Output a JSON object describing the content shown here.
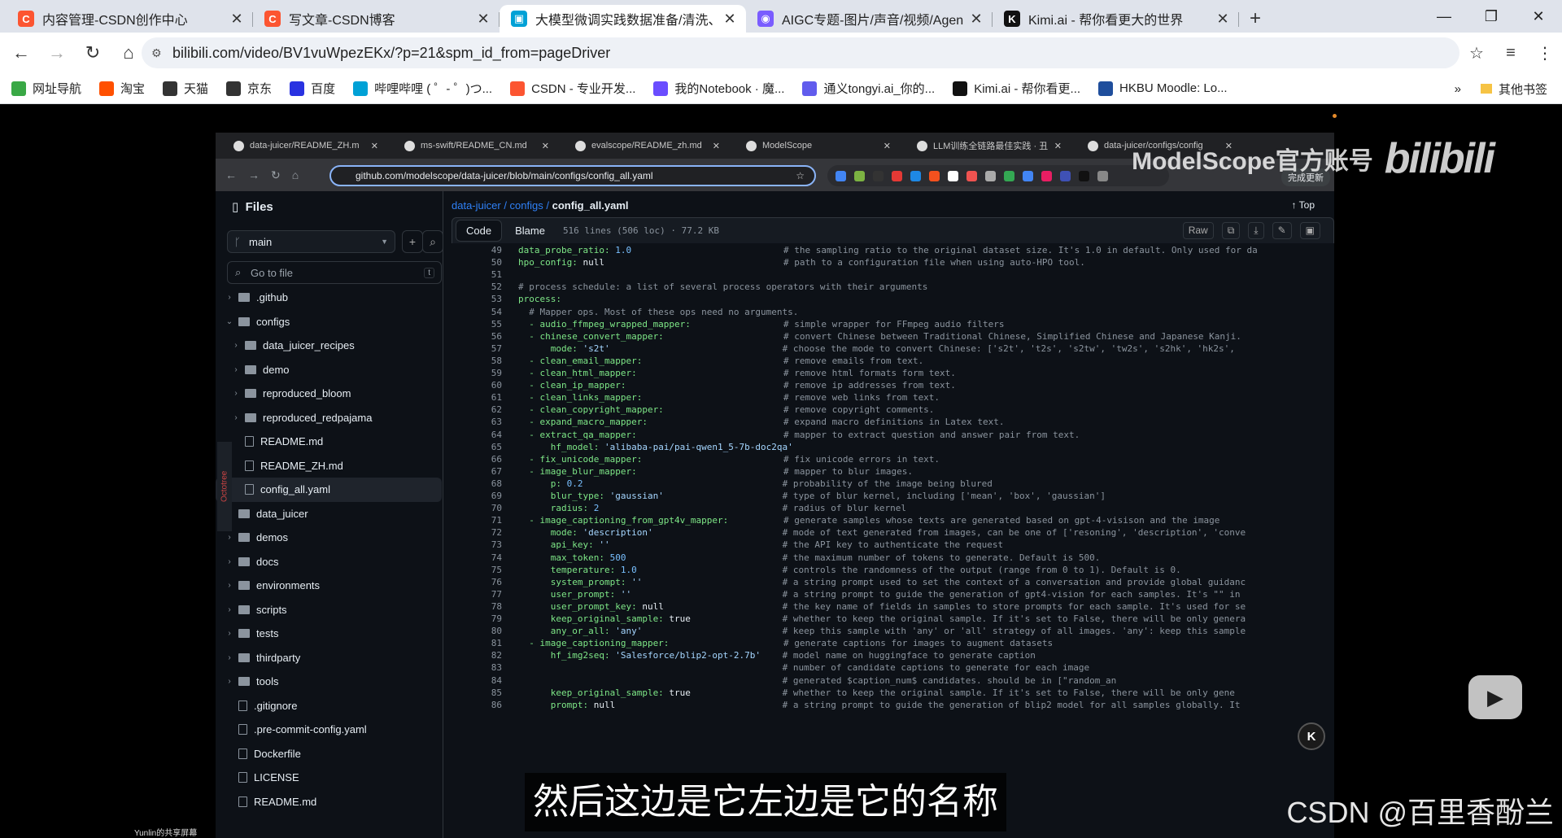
{
  "browser": {
    "tabs": [
      {
        "title": "内容管理-CSDN创作中心",
        "fav": "C",
        "color": "#fc5531"
      },
      {
        "title": "写文章-CSDN博客",
        "fav": "C",
        "color": "#fc5531"
      },
      {
        "title": "大模型微调实践数据准备/清洗、",
        "fav": "▣",
        "color": "#00a1d6",
        "active": true
      },
      {
        "title": "AIGC专题-图片/声音/视频/Agen",
        "fav": "◉",
        "color": "#7a5cff"
      },
      {
        "title": "Kimi.ai - 帮你看更大的世界",
        "fav": "K",
        "color": "#111111"
      }
    ],
    "url": "bilibili.com/video/BV1vuWpezEKx/?p=21&spm_id_from=pageDriver",
    "bookmarks": [
      {
        "label": "网址导航",
        "color": "#39a845"
      },
      {
        "label": "淘宝",
        "color": "#ff5000"
      },
      {
        "label": "天猫",
        "color": "#333333"
      },
      {
        "label": "京东",
        "color": "#333333"
      },
      {
        "label": "百度",
        "color": "#2932e1"
      },
      {
        "label": "哔哩哔哩 ( ゜- ゜)つ...",
        "color": "#00a1d6"
      },
      {
        "label": "CSDN - 专业开发...",
        "color": "#fc5531"
      },
      {
        "label": "我的Notebook · 魔...",
        "color": "#6a4dff"
      },
      {
        "label": "通义tongyi.ai_你的...",
        "color": "#615ced"
      },
      {
        "label": "Kimi.ai - 帮你看更...",
        "color": "#111111"
      },
      {
        "label": "HKBU Moodle: Lo...",
        "color": "#1f4e9c"
      }
    ],
    "other_bookmarks": "其他书签"
  },
  "inner": {
    "tabs": [
      "data-juicer/README_ZH.m",
      "ms-swift/README_CN.md",
      "evalscope/README_zh.md",
      "ModelScope",
      "LLM训练全链路最佳实践 · 丑",
      "data-juicer/configs/config"
    ],
    "url": "github.com/modelscope/data-juicer/blob/main/configs/config_all.yaml",
    "update_btn": "完成更新",
    "files_title": "Files",
    "branch": "main",
    "goto": "Go to file",
    "goto_key": "t",
    "octotree": "Octotree",
    "tree": [
      {
        "name": ".github",
        "type": "folder",
        "depth": 0,
        "caret": "›"
      },
      {
        "name": "configs",
        "type": "folder",
        "depth": 0,
        "caret": "⌄"
      },
      {
        "name": "data_juicer_recipes",
        "type": "folder",
        "depth": 1,
        "caret": "›"
      },
      {
        "name": "demo",
        "type": "folder",
        "depth": 1,
        "caret": "›"
      },
      {
        "name": "reproduced_bloom",
        "type": "folder",
        "depth": 1,
        "caret": "›"
      },
      {
        "name": "reproduced_redpajama",
        "type": "folder",
        "depth": 1,
        "caret": "›"
      },
      {
        "name": "README.md",
        "type": "file",
        "depth": 1,
        "caret": ""
      },
      {
        "name": "README_ZH.md",
        "type": "file",
        "depth": 1,
        "caret": ""
      },
      {
        "name": "config_all.yaml",
        "type": "file",
        "depth": 1,
        "caret": "",
        "selected": true
      },
      {
        "name": "data_juicer",
        "type": "folder",
        "depth": 0,
        "caret": "›"
      },
      {
        "name": "demos",
        "type": "folder",
        "depth": 0,
        "caret": "›"
      },
      {
        "name": "docs",
        "type": "folder",
        "depth": 0,
        "caret": "›"
      },
      {
        "name": "environments",
        "type": "folder",
        "depth": 0,
        "caret": "›"
      },
      {
        "name": "scripts",
        "type": "folder",
        "depth": 0,
        "caret": "›"
      },
      {
        "name": "tests",
        "type": "folder",
        "depth": 0,
        "caret": "›"
      },
      {
        "name": "thirdparty",
        "type": "folder",
        "depth": 0,
        "caret": "›"
      },
      {
        "name": "tools",
        "type": "folder",
        "depth": 0,
        "caret": "›"
      },
      {
        "name": ".gitignore",
        "type": "file",
        "depth": 0,
        "caret": ""
      },
      {
        "name": ".pre-commit-config.yaml",
        "type": "file",
        "depth": 0,
        "caret": ""
      },
      {
        "name": "Dockerfile",
        "type": "file",
        "depth": 0,
        "caret": ""
      },
      {
        "name": "LICENSE",
        "type": "file",
        "depth": 0,
        "caret": ""
      },
      {
        "name": "README.md",
        "type": "file",
        "depth": 0,
        "caret": ""
      }
    ],
    "breadcrumb": {
      "repo": "data-juicer",
      "sep": " / ",
      "dir": "configs",
      "file": "config_all.yaml"
    },
    "top": "↑ Top",
    "code_tab": "Code",
    "blame_tab": "Blame",
    "file_info": "516 lines (506 loc) · 77.2 KB",
    "raw": "Raw",
    "code": [
      {
        "n": "49",
        "k": "data_probe_ratio:",
        "v": " 1.0",
        "vt": "n",
        "ind": 0,
        "c": "# the sampling ratio to the original dataset size. It's 1.0 in default. Only used for da"
      },
      {
        "n": "50",
        "k": "hpo_config:",
        "v": " null",
        "vt": "t",
        "ind": 0,
        "c": "# path to a configuration file when using auto-HPO tool."
      },
      {
        "n": "51",
        "k": "",
        "v": "",
        "vt": "t",
        "ind": 0,
        "c": ""
      },
      {
        "n": "52",
        "k": "",
        "v": "# process schedule: a list of several process operators with their arguments",
        "vt": "c",
        "ind": 0,
        "c": ""
      },
      {
        "n": "53",
        "k": "process:",
        "v": "",
        "vt": "t",
        "ind": 0,
        "c": ""
      },
      {
        "n": "54",
        "k": "",
        "v": "  # Mapper ops. Most of these ops need no arguments.",
        "vt": "c",
        "ind": 0,
        "c": ""
      },
      {
        "n": "55",
        "k": "  - audio_ffmpeg_wrapped_mapper:",
        "v": "",
        "vt": "t",
        "ind": 0,
        "c": "# simple wrapper for FFmpeg audio filters"
      },
      {
        "n": "56",
        "k": "  - chinese_convert_mapper:",
        "v": "",
        "vt": "t",
        "ind": 0,
        "c": "# convert Chinese between Traditional Chinese, Simplified Chinese and Japanese Kanji."
      },
      {
        "n": "57",
        "k": "      mode:",
        "v": " 's2t'",
        "vt": "s",
        "ind": 0,
        "c": " # choose the mode to convert Chinese: ['s2t', 't2s', 's2tw', 'tw2s', 's2hk', 'hk2s',"
      },
      {
        "n": "58",
        "k": "  - clean_email_mapper:",
        "v": "",
        "vt": "t",
        "ind": 0,
        "c": "# remove emails from text."
      },
      {
        "n": "59",
        "k": "  - clean_html_mapper:",
        "v": "",
        "vt": "t",
        "ind": 0,
        "c": "# remove html formats form text."
      },
      {
        "n": "60",
        "k": "  - clean_ip_mapper:",
        "v": "",
        "vt": "t",
        "ind": 0,
        "c": "# remove ip addresses from text."
      },
      {
        "n": "61",
        "k": "  - clean_links_mapper:",
        "v": "",
        "vt": "t",
        "ind": 0,
        "c": "# remove web links from text."
      },
      {
        "n": "62",
        "k": "  - clean_copyright_mapper:",
        "v": "",
        "vt": "t",
        "ind": 0,
        "c": "# remove copyright comments."
      },
      {
        "n": "63",
        "k": "  - expand_macro_mapper:",
        "v": "",
        "vt": "t",
        "ind": 0,
        "c": "# expand macro definitions in Latex text."
      },
      {
        "n": "64",
        "k": "  - extract_qa_mapper:",
        "v": "",
        "vt": "t",
        "ind": 0,
        "c": "# mapper to extract question and answer pair from text."
      },
      {
        "n": "65",
        "k": "      hf_model:",
        "v": " 'alibaba-pai/pai-qwen1_5-7b-doc2qa'",
        "vt": "s",
        "ind": 0,
        "c": ""
      },
      {
        "n": "66",
        "k": "  - fix_unicode_mapper:",
        "v": "",
        "vt": "t",
        "ind": 0,
        "c": "# fix unicode errors in text."
      },
      {
        "n": "67",
        "k": "  - image_blur_mapper:",
        "v": "",
        "vt": "t",
        "ind": 0,
        "c": "# mapper to blur images."
      },
      {
        "n": "68",
        "k": "      p:",
        "v": " 0.2",
        "vt": "n",
        "ind": 0,
        "c": " # probability of the image being blured"
      },
      {
        "n": "69",
        "k": "      blur_type:",
        "v": " 'gaussian'",
        "vt": "s",
        "ind": 0,
        "c": " # type of blur kernel, including ['mean', 'box', 'gaussian']"
      },
      {
        "n": "70",
        "k": "      radius:",
        "v": " 2",
        "vt": "n",
        "ind": 0,
        "c": " # radius of blur kernel"
      },
      {
        "n": "71",
        "k": "  - image_captioning_from_gpt4v_mapper:",
        "v": "",
        "vt": "t",
        "ind": 0,
        "c": "# generate samples whose texts are generated based on gpt-4-visison and the image"
      },
      {
        "n": "72",
        "k": "      mode:",
        "v": " 'description'",
        "vt": "s",
        "ind": 0,
        "c": " # mode of text generated from images, can be one of ['resoning', 'description', 'conve"
      },
      {
        "n": "73",
        "k": "      api_key:",
        "v": " ''",
        "vt": "s",
        "ind": 0,
        "c": " # the API key to authenticate the request"
      },
      {
        "n": "74",
        "k": "      max_token:",
        "v": " 500",
        "vt": "n",
        "ind": 0,
        "c": " # the maximum number of tokens to generate. Default is 500."
      },
      {
        "n": "75",
        "k": "      temperature:",
        "v": " 1.0",
        "vt": "n",
        "ind": 0,
        "c": " # controls the randomness of the output (range from 0 to 1). Default is 0."
      },
      {
        "n": "76",
        "k": "      system_prompt:",
        "v": " ''",
        "vt": "s",
        "ind": 0,
        "c": " # a string prompt used to set the context of a conversation and provide global guidanc"
      },
      {
        "n": "77",
        "k": "      user_prompt:",
        "v": " ''",
        "vt": "s",
        "ind": 0,
        "c": " # a string prompt to guide the generation of gpt4-vision for each samples. It's \"\" in"
      },
      {
        "n": "78",
        "k": "      user_prompt_key:",
        "v": " null",
        "vt": "t",
        "ind": 0,
        "c": " # the key name of fields in samples to store prompts for each sample. It's used for se"
      },
      {
        "n": "79",
        "k": "      keep_original_sample:",
        "v": " true",
        "vt": "t",
        "ind": 0,
        "c": " # whether to keep the original sample. If it's set to False, there will be only genera"
      },
      {
        "n": "80",
        "k": "      any_or_all:",
        "v": " 'any'",
        "vt": "s",
        "ind": 0,
        "c": " # keep this sample with 'any' or 'all' strategy of all images. 'any': keep this sample"
      },
      {
        "n": "81",
        "k": "  - image_captioning_mapper:",
        "v": "",
        "vt": "t",
        "ind": 0,
        "c": "# generate captions for images to augment datasets"
      },
      {
        "n": "82",
        "k": "      hf_img2seq:",
        "v": " 'Salesforce/blip2-opt-2.7b'",
        "vt": "s",
        "ind": 0,
        "c": " # model name on huggingface to generate caption"
      },
      {
        "n": "83",
        "k": "",
        "v": "",
        "vt": "t",
        "ind": 0,
        "c": " # number of candidate captions to generate for each image"
      },
      {
        "n": "84",
        "k": "",
        "v": "",
        "vt": "t",
        "ind": 0,
        "c": " # generated $caption_num$ candidates. should be in [\"random_an"
      },
      {
        "n": "85",
        "k": "      keep_original_sample:",
        "v": " true",
        "vt": "t",
        "ind": 0,
        "c": " # whether to keep the original sample. If it's set to False, there will be only gene"
      },
      {
        "n": "86",
        "k": "      prompt:",
        "v": " null",
        "vt": "t",
        "ind": 0,
        "c": " # a string prompt to guide the generation of blip2 model for all samples globally. It"
      }
    ]
  },
  "overlay": {
    "watermark": "ModelScope官方账号",
    "bili_logo": "bilibili",
    "subtitle": "然后这边是它左边是它的名称",
    "csdn": "CSDN @百里香酚兰",
    "share": "Yunlin的共享屏幕",
    "kimi": "K"
  }
}
